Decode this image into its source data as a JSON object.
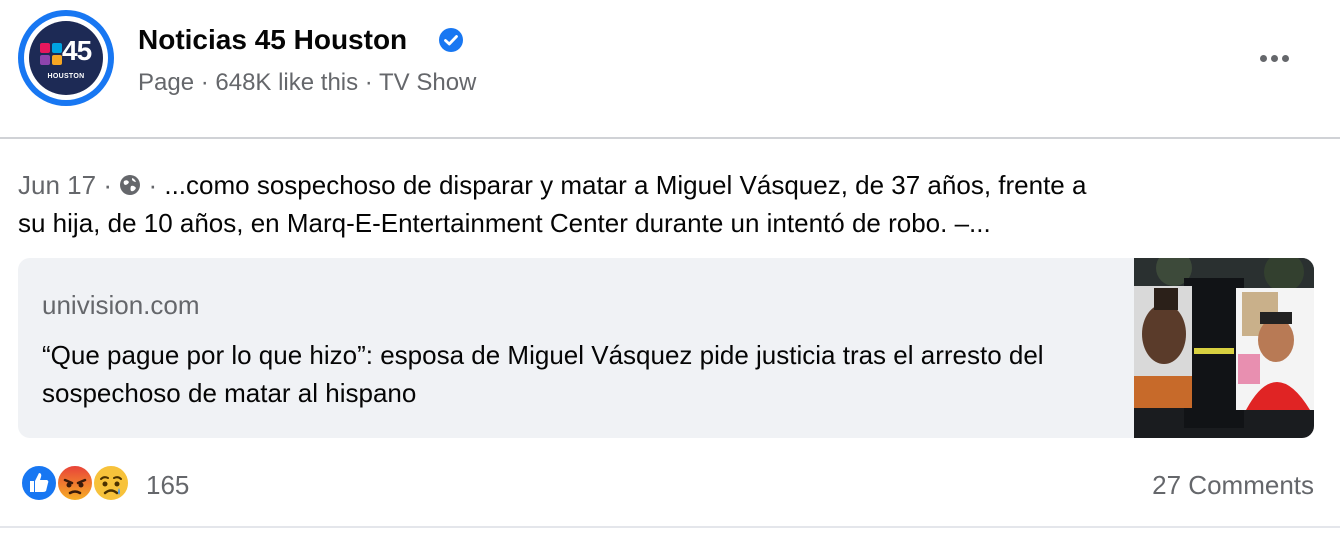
{
  "header": {
    "page_name": "Noticias 45 Houston",
    "meta": "Page · 648K like this · TV Show",
    "logo_number": "45",
    "logo_city": "HOUSTON"
  },
  "post": {
    "date": "Jun 17",
    "separator": "·",
    "text_line1": "...como sospechoso de disparar y matar a Miguel Vásquez, de 37 años, frente a",
    "text_line2": "su hija, de 10 años, en Marq-E-Entertainment Center durante un intentó de robo. –..."
  },
  "link_card": {
    "domain": "univision.com",
    "title": "“Que pague por lo que hizo”: esposa de Miguel Vásquez pide justicia tras el arresto del sospechoso de matar al hispano"
  },
  "footer": {
    "reaction_count": "165",
    "comments": "27 Comments",
    "reactions": [
      "like-icon",
      "angry-icon",
      "sad-icon"
    ]
  },
  "colors": {
    "accent": "#1877f2",
    "secondary_text": "#65676b",
    "card_bg": "#f0f2f5"
  }
}
